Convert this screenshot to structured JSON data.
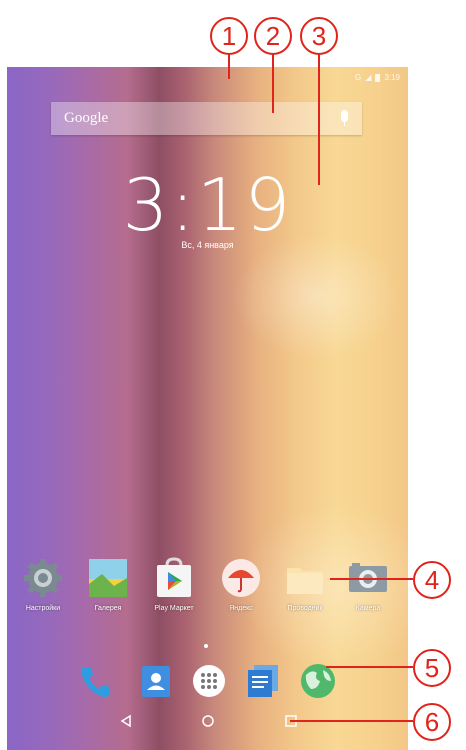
{
  "status_bar": {
    "signal_label": "G",
    "time": "3:19"
  },
  "search": {
    "brand": "Google"
  },
  "clock": {
    "time": "3:19",
    "date": "Вс, 4 января"
  },
  "apps": [
    {
      "label": "Настройки",
      "icon": "gear-icon"
    },
    {
      "label": "Галерея",
      "icon": "gallery-icon"
    },
    {
      "label": "Play Маркет",
      "icon": "play-store-icon"
    },
    {
      "label": "Яндекс",
      "icon": "yandex-icon"
    },
    {
      "label": "Проводник",
      "icon": "folder-icon"
    },
    {
      "label": "Камера",
      "icon": "camera-icon"
    }
  ],
  "dock": [
    "phone-icon",
    "contacts-icon",
    "app-drawer-icon",
    "messages-icon",
    "browser-icon"
  ],
  "callouts": [
    "1",
    "2",
    "3",
    "4",
    "5",
    "6"
  ],
  "colors": {
    "callout": "#e0241b"
  }
}
